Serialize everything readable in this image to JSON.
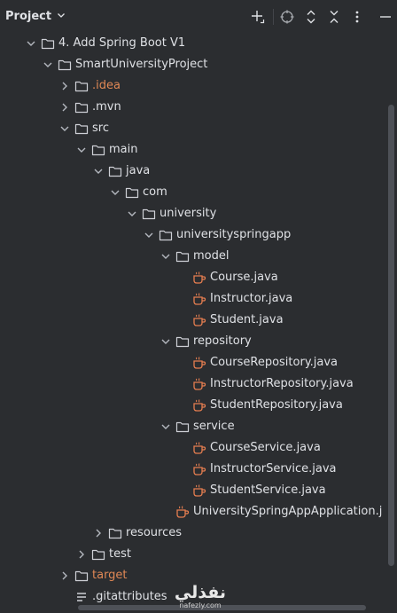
{
  "panel": {
    "title": "Project"
  },
  "toolbar": {
    "icons": [
      "add-icon",
      "locate-icon",
      "expand-all-icon",
      "collapse-all-icon",
      "more-icon"
    ]
  },
  "colors": {
    "folder": "#ced0d6",
    "java_file": "#e67e50",
    "excluded_text": "#e08855",
    "text": "#dfe1e5",
    "background": "#2b2d30"
  },
  "tree": [
    {
      "label": "4. Add Spring Boot V1",
      "level": 0,
      "kind": "folder",
      "state": "open"
    },
    {
      "label": "SmartUniversityProject",
      "level": 1,
      "kind": "folder",
      "state": "open"
    },
    {
      "label": ".idea",
      "level": 2,
      "kind": "folder",
      "state": "closed",
      "style": "excluded"
    },
    {
      "label": ".mvn",
      "level": 2,
      "kind": "folder",
      "state": "closed"
    },
    {
      "label": "src",
      "level": 2,
      "kind": "folder",
      "state": "open"
    },
    {
      "label": "main",
      "level": 3,
      "kind": "folder",
      "state": "open"
    },
    {
      "label": "java",
      "level": 4,
      "kind": "folder",
      "state": "open"
    },
    {
      "label": "com",
      "level": 5,
      "kind": "folder",
      "state": "open"
    },
    {
      "label": "university",
      "level": 6,
      "kind": "folder",
      "state": "open"
    },
    {
      "label": "universityspringapp",
      "level": 7,
      "kind": "folder",
      "state": "open"
    },
    {
      "label": "model",
      "level": 8,
      "kind": "folder",
      "state": "open"
    },
    {
      "label": "Course.java",
      "level": 9,
      "kind": "java"
    },
    {
      "label": "Instructor.java",
      "level": 9,
      "kind": "java"
    },
    {
      "label": "Student.java",
      "level": 9,
      "kind": "java"
    },
    {
      "label": "repository",
      "level": 8,
      "kind": "folder",
      "state": "open"
    },
    {
      "label": "CourseRepository.java",
      "level": 9,
      "kind": "java"
    },
    {
      "label": "InstructorRepository.java",
      "level": 9,
      "kind": "java"
    },
    {
      "label": "StudentRepository.java",
      "level": 9,
      "kind": "java"
    },
    {
      "label": "service",
      "level": 8,
      "kind": "folder",
      "state": "open"
    },
    {
      "label": "CourseService.java",
      "level": 9,
      "kind": "java"
    },
    {
      "label": "InstructorService.java",
      "level": 9,
      "kind": "java"
    },
    {
      "label": "StudentService.java",
      "level": 9,
      "kind": "java"
    },
    {
      "label": "UniversitySpringAppApplication.java",
      "level": 8,
      "kind": "java"
    },
    {
      "label": "resources",
      "level": 4,
      "kind": "folder",
      "state": "closed"
    },
    {
      "label": "test",
      "level": 3,
      "kind": "folder",
      "state": "closed"
    },
    {
      "label": "target",
      "level": 2,
      "kind": "folder",
      "state": "closed",
      "style": "excluded"
    },
    {
      "label": ".gitattributes",
      "level": 2,
      "kind": "text-file"
    }
  ],
  "watermark": {
    "arabic": "نفذلي",
    "site": "nafezly.com"
  }
}
